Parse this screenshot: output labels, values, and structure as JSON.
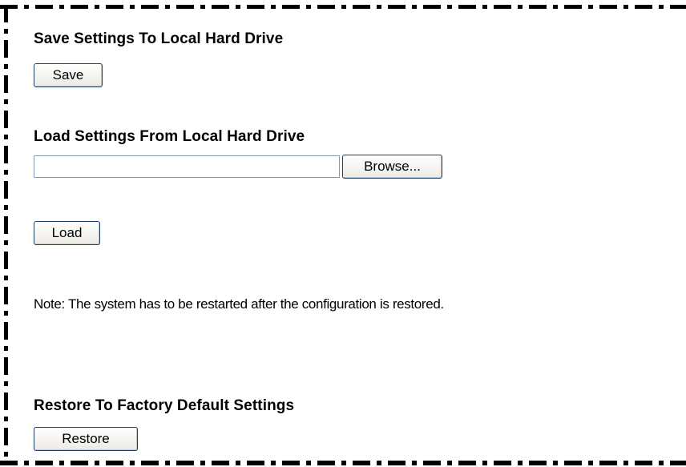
{
  "save_section": {
    "heading": "Save Settings To Local Hard Drive",
    "save_label": "Save"
  },
  "load_section": {
    "heading": "Load Settings From Local Hard Drive",
    "file_value": "",
    "browse_label": "Browse...",
    "load_label": "Load"
  },
  "note": "Note: The system has to be restarted after the configuration is restored.",
  "restore_section": {
    "heading": "Restore To Factory Default Settings",
    "restore_label": "Restore"
  }
}
